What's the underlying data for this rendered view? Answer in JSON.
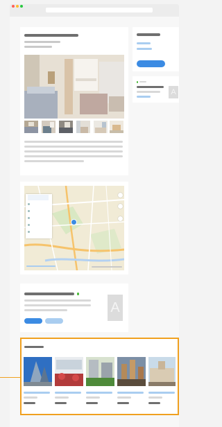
{
  "colors": {
    "accent": "#3b8be3",
    "accent_light": "#a9cdf0",
    "highlight": "#f0a01f",
    "status_green": "#4cbb3a"
  },
  "icons": [
    "avatar-placeholder-icon",
    "map-pin-icon",
    "zoom-in-icon",
    "zoom-out-icon",
    "pencil-icon"
  ],
  "avatar_letter": "A",
  "map": {
    "filters": [
      "",
      "",
      "",
      "",
      "",
      ""
    ]
  }
}
